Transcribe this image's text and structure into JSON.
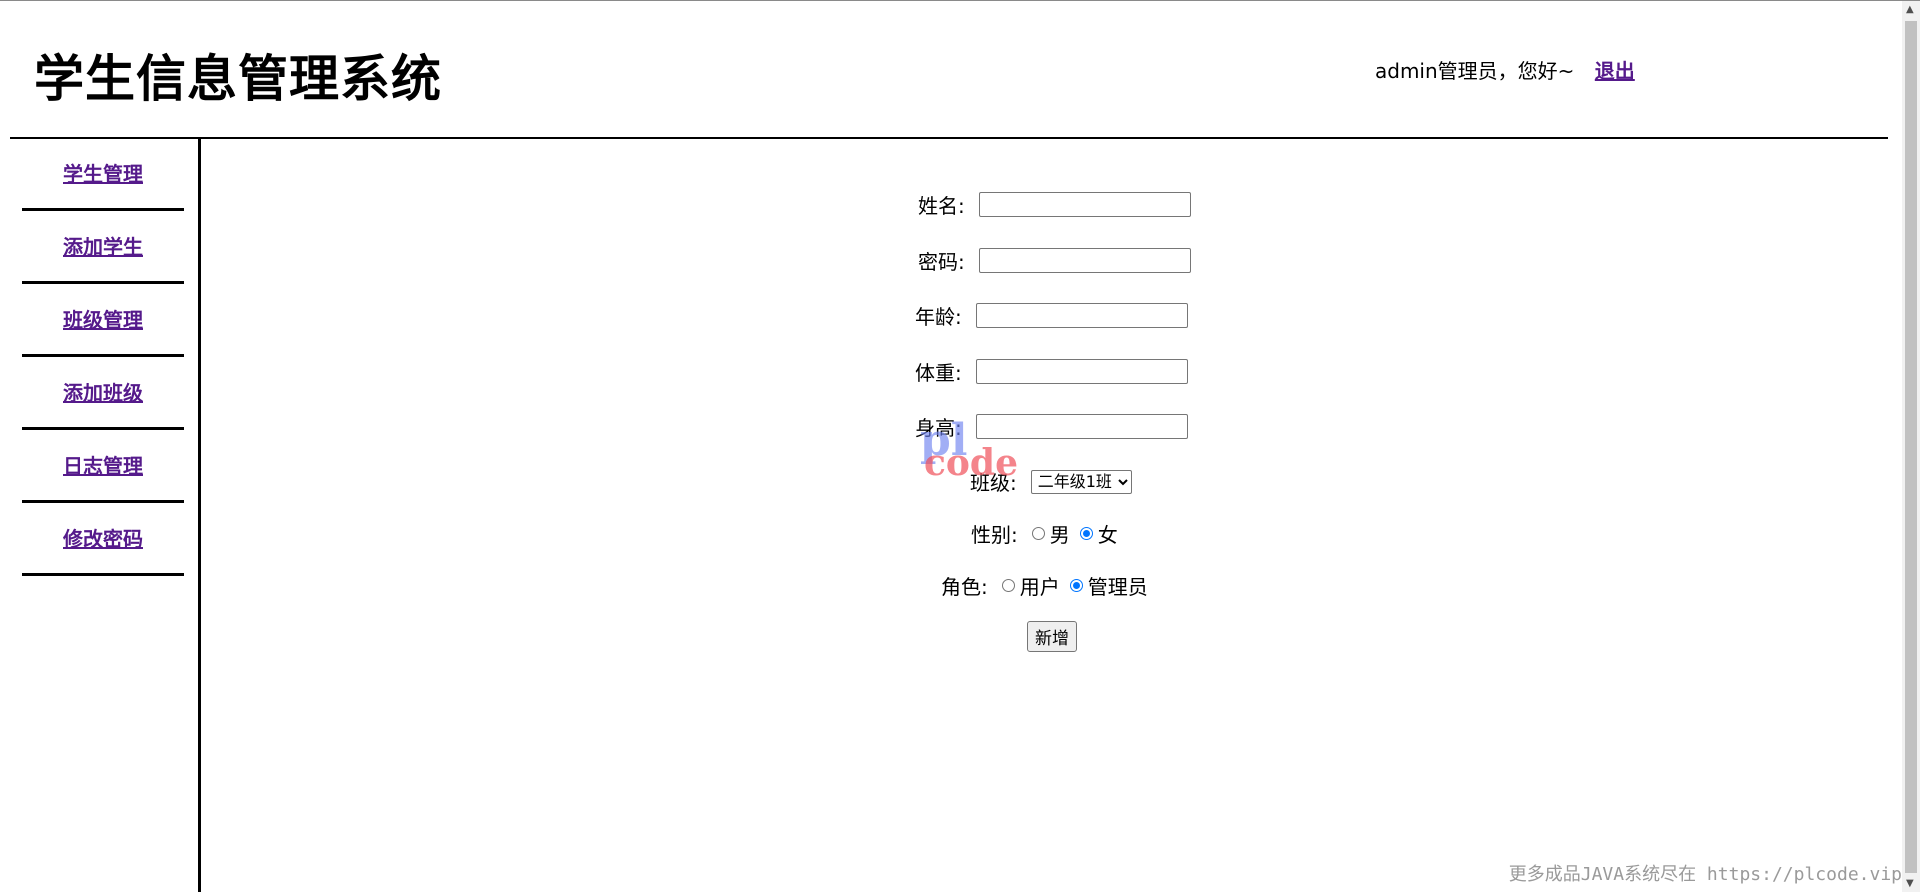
{
  "header": {
    "title": "学生信息管理系统",
    "greeting": "admin管理员，您好~",
    "logout_label": "退出"
  },
  "sidebar": {
    "items": [
      {
        "label": "学生管理"
      },
      {
        "label": "添加学生"
      },
      {
        "label": "班级管理"
      },
      {
        "label": "添加班级"
      },
      {
        "label": "日志管理"
      },
      {
        "label": "修改密码"
      }
    ]
  },
  "form": {
    "name_label": "姓名:",
    "name_value": "",
    "password_label": "密码:",
    "password_value": "",
    "age_label": "年龄:",
    "age_value": "",
    "weight_label": "体重:",
    "weight_value": "",
    "height_label": "身高:",
    "height_value": "",
    "class_label": "班级:",
    "class_selected": "二年级1班",
    "gender_label": "性别:",
    "gender_options": [
      "男",
      "女"
    ],
    "gender_selected": "女",
    "role_label": "角色:",
    "role_options": [
      "用户",
      "管理员"
    ],
    "role_selected": "管理员",
    "submit_label": "新增"
  },
  "watermark": {
    "logo_line1": "pl",
    "logo_line2": "code",
    "footer": "更多成品JAVA系统尽在 https://plcode.vip"
  },
  "colors": {
    "link": "#551a8b",
    "radio_checked": "#0075ff"
  }
}
